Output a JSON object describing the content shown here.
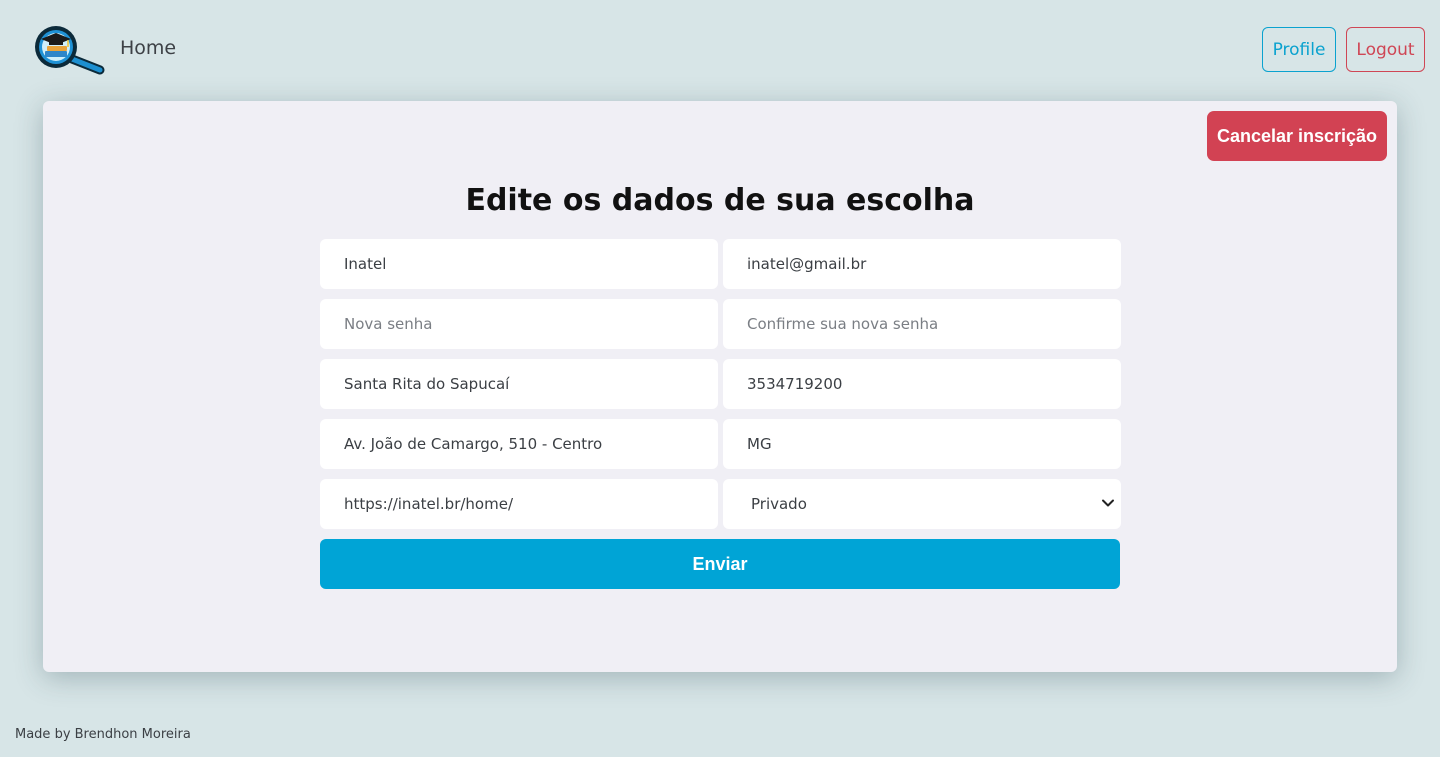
{
  "nav": {
    "logo_icon": "magnifier-graduation-cap-logo-icon",
    "home_label": "Home",
    "profile_label": "Profile",
    "logout_label": "Logout"
  },
  "card": {
    "cancel_label": "Cancelar inscrição",
    "title": "Edite os dados de sua escolha",
    "fields": {
      "name": {
        "value": "Inatel"
      },
      "email": {
        "value": "inatel@gmail.br"
      },
      "password": {
        "placeholder": "Nova senha"
      },
      "password_confirm": {
        "placeholder": "Confirme sua nova senha"
      },
      "city": {
        "value": "Santa Rita do Sapucaí"
      },
      "phone": {
        "value": "3534719200"
      },
      "address": {
        "value": "Av. João de Camargo, 510 - Centro"
      },
      "state": {
        "value": "MG"
      },
      "website": {
        "value": "https://inatel.br/home/"
      },
      "type": {
        "selected": "Privado",
        "icon": "chevron-down-icon"
      }
    },
    "submit_label": "Enviar"
  },
  "footer": {
    "text": "Made by Brendhon Moreira"
  },
  "colors": {
    "page_bg": "#d7e5e7",
    "card_bg": "#f0eff5",
    "primary": "#00a4d6",
    "danger": "#d24253",
    "info_outline": "#0aa2cf"
  }
}
